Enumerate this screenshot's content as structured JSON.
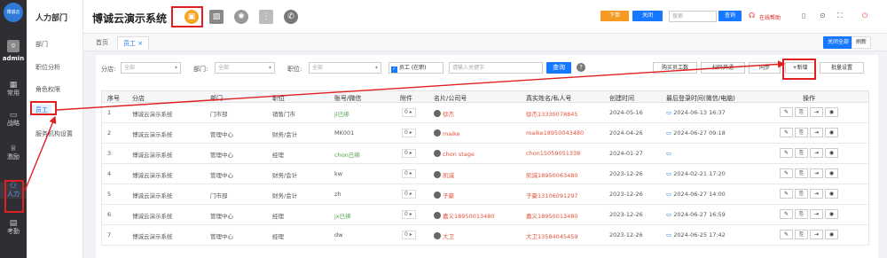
{
  "rail": {
    "logo_text": "博诚云",
    "admin_label": "admin",
    "items": [
      {
        "label": "常用",
        "icon": "grid-icon"
      },
      {
        "label": "战略",
        "icon": "briefcase-icon"
      },
      {
        "label": "激励",
        "icon": "crown-icon"
      },
      {
        "label": "人力",
        "icon": "people-icon"
      },
      {
        "label": "考勤",
        "icon": "calendar-icon"
      }
    ]
  },
  "submenu": {
    "title": "人力部门",
    "items": [
      "部门",
      "职位分析",
      "角色权限",
      "员工",
      "服务机构设置"
    ]
  },
  "header": {
    "title": "博诚云演示系统",
    "btn_download": "下单",
    "btn_close": "关闭",
    "search_placeholder": "搜索",
    "btn_search": "查询",
    "online_help": "在线帮助"
  },
  "tabs": {
    "items": [
      "首页",
      "员工"
    ],
    "close_all": "关闭全部",
    "refresh": "刷新"
  },
  "filters": {
    "branch_label": "分店:",
    "branch_value": "全部",
    "dept_label": "部门:",
    "dept_value": "全部",
    "post_label": "职位:",
    "post_value": "全部",
    "status_value": "员工 (在职)",
    "keyword_placeholder": "请输入关键字",
    "query_btn": "查询",
    "btn_payroll": "购买员工数",
    "btn_hr": "扫码开通",
    "btn_sync": "同步",
    "btn_add": "+新增",
    "btn_batch": "批量设置"
  },
  "table": {
    "headers": [
      "序号",
      "分店",
      "部门",
      "职位",
      "账号/微信",
      "附件",
      "名片/公司号",
      "真实姓名/私人号",
      "创建时间",
      "最后登录时间(微信/电脑)",
      "操作"
    ],
    "rows": [
      {
        "no": "1",
        "branch": "博诚云演示系统",
        "dept": "门市部",
        "post": "销售门市",
        "account": "jl已绑",
        "att": "0",
        "card": "徐杰",
        "real": "徐杰13330078845",
        "created": "2024-05-16",
        "last": "2024-06-13 16:37"
      },
      {
        "no": "2",
        "branch": "博诚云演示系统",
        "dept": "管理中心",
        "post": "财务/会计",
        "account": "MK001",
        "att": "0",
        "card": "maike",
        "real": "maike18950043480",
        "created": "2024-04-26",
        "last": "2024-06-27 09:18"
      },
      {
        "no": "3",
        "branch": "博诚云演示系统",
        "dept": "管理中心",
        "post": "经理",
        "account": "chon已绑",
        "att": "0",
        "card": "chon stage",
        "real": "chon15059051338",
        "created": "2024-01-27",
        "last": ""
      },
      {
        "no": "4",
        "branch": "博诚云演示系统",
        "dept": "管理中心",
        "post": "财务/会计",
        "account": "kw",
        "att": "0",
        "card": "凯诚",
        "real": "凯诚18950063480",
        "created": "2023-12-26",
        "last": "2024-02-21 17:20"
      },
      {
        "no": "5",
        "branch": "博诚云演示系统",
        "dept": "门市部",
        "post": "财务/会计",
        "account": "zh",
        "att": "0",
        "card": "子豪",
        "real": "子豪13106091297",
        "created": "2023-12-26",
        "last": "2024-06-27 14:00"
      },
      {
        "no": "6",
        "branch": "博诚云演示系统",
        "dept": "管理中心",
        "post": "经理",
        "account": "jx已绑",
        "att": "0",
        "card": "嘉义18950013480",
        "real": "嘉义18950013480",
        "created": "2023-12-26",
        "last": "2024-06-27 16:59"
      },
      {
        "no": "7",
        "branch": "博诚云演示系统",
        "dept": "管理中心",
        "post": "经理",
        "account": "dw",
        "att": "0",
        "card": "大卫",
        "real": "大卫13584045459",
        "created": "2023-12-26",
        "last": "2024-06-25 17:42"
      }
    ],
    "ops": [
      "✎",
      "⎘",
      "⇥",
      "◉"
    ]
  }
}
